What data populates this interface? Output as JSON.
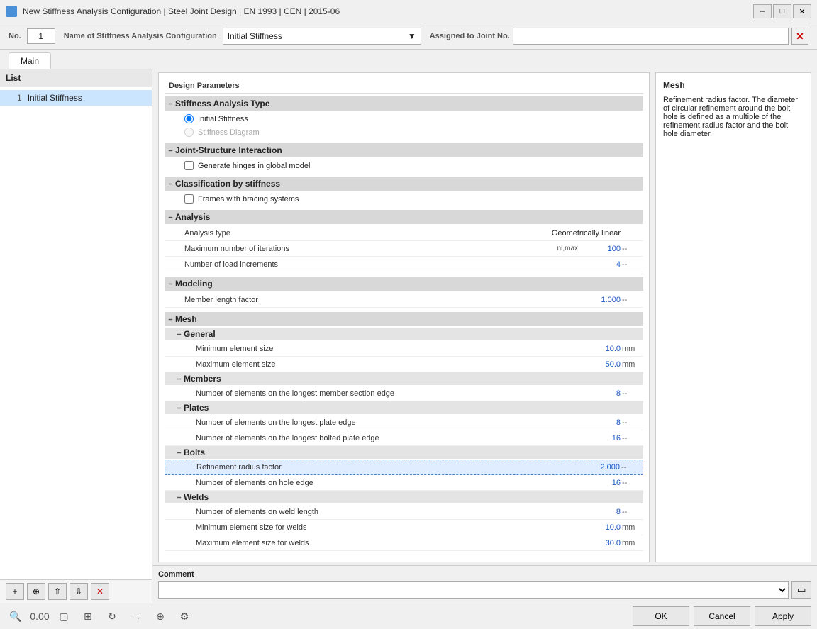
{
  "titleBar": {
    "title": "New Stiffness Analysis Configuration | Steel Joint Design | EN 1993 | CEN | 2015-06"
  },
  "configBar": {
    "noLabel": "No.",
    "noValue": "1",
    "nameLabel": "Name of Stiffness Analysis Configuration",
    "nameValue": "Initial Stiffness",
    "assignedLabel": "Assigned to Joint No.",
    "assignedValue": ""
  },
  "tabs": [
    "Main"
  ],
  "designParams": {
    "sectionLabel": "Design Parameters",
    "stiffnessAnalysisType": {
      "label": "Stiffness Analysis Type",
      "options": [
        "Initial Stiffness",
        "Stiffness Diagram"
      ],
      "selected": "Initial Stiffness"
    },
    "jointStructure": {
      "label": "Joint-Structure Interaction",
      "generateHinges": "Generate hinges in global model",
      "checked": false
    },
    "classificationByStiffness": {
      "label": "Classification by stiffness",
      "framesWithBracing": "Frames with bracing systems",
      "checked": false
    },
    "analysis": {
      "label": "Analysis",
      "rows": [
        {
          "label": "Analysis type",
          "value": "Geometrically linear",
          "unit": ""
        },
        {
          "label": "Maximum number of iterations",
          "subscript": "ni,max",
          "value": "100",
          "unit": "--"
        },
        {
          "label": "Number of load increments",
          "value": "4",
          "unit": "--"
        }
      ]
    },
    "modeling": {
      "label": "Modeling",
      "rows": [
        {
          "label": "Member length factor",
          "value": "1.000",
          "unit": "--"
        }
      ]
    },
    "mesh": {
      "label": "Mesh",
      "general": {
        "label": "General",
        "rows": [
          {
            "label": "Minimum element size",
            "value": "10.0",
            "unit": "mm"
          },
          {
            "label": "Maximum element size",
            "value": "50.0",
            "unit": "mm"
          }
        ]
      },
      "members": {
        "label": "Members",
        "rows": [
          {
            "label": "Number of elements on the longest member section edge",
            "value": "8",
            "unit": "--"
          }
        ]
      },
      "plates": {
        "label": "Plates",
        "rows": [
          {
            "label": "Number of elements on the longest plate edge",
            "value": "8",
            "unit": "--"
          },
          {
            "label": "Number of elements on the longest bolted plate edge",
            "value": "16",
            "unit": "--"
          }
        ]
      },
      "bolts": {
        "label": "Bolts",
        "rows": [
          {
            "label": "Refinement radius factor",
            "value": "2.000",
            "unit": "--",
            "highlighted": true
          },
          {
            "label": "Number of elements on hole edge",
            "value": "16",
            "unit": "--"
          }
        ]
      },
      "welds": {
        "label": "Welds",
        "rows": [
          {
            "label": "Number of elements on weld length",
            "value": "8",
            "unit": "--"
          },
          {
            "label": "Minimum element size for welds",
            "value": "10.0",
            "unit": "mm"
          },
          {
            "label": "Maximum element size for welds",
            "value": "30.0",
            "unit": "mm"
          }
        ]
      }
    }
  },
  "infoPanel": {
    "title": "Mesh",
    "text": "Refinement radius factor. The diameter of circular refinement around the bolt hole is defined as a multiple of the refinement radius factor and the bolt hole diameter."
  },
  "comment": {
    "label": "Comment",
    "placeholder": "",
    "copyBtnLabel": "⧉"
  },
  "listPanel": {
    "header": "List",
    "items": [
      {
        "no": 1,
        "name": "Initial Stiffness"
      }
    ]
  },
  "bottomToolbar": {
    "icons": [
      "🔍",
      "0.00",
      "□",
      "⊞",
      "↺",
      "→",
      "⊕",
      "⚙"
    ]
  },
  "dialogButtons": {
    "ok": "OK",
    "cancel": "Cancel",
    "apply": "Apply"
  }
}
